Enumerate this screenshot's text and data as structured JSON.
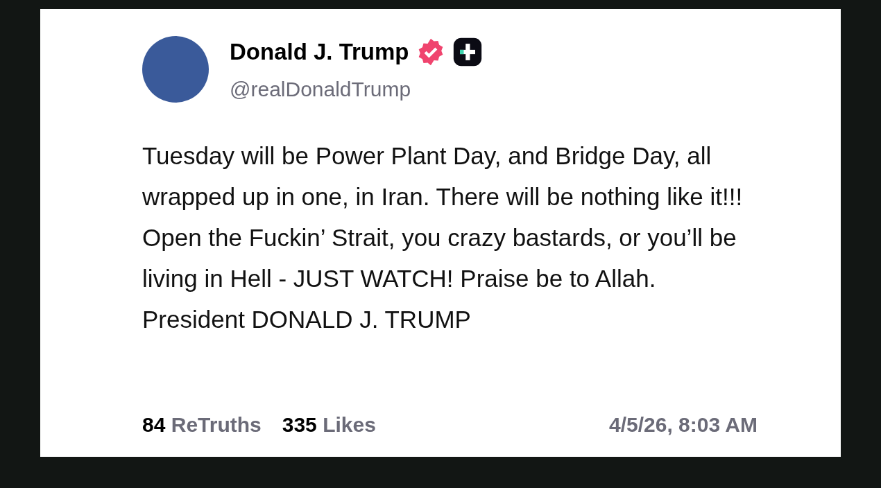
{
  "post": {
    "author": {
      "name": "Donald J. Trump",
      "handle": "@realDonaldTrump",
      "verified": true
    },
    "text": "Tuesday will be Power Plant Day, and Bridge Day, all wrapped up in one, in Iran. There will be nothing like it!!! Open the Fuckin’ Strait, you crazy bastards, or you’ll be living in Hell - JUST WATCH! Praise be to Allah. President DONALD J. TRUMP",
    "stats": [
      {
        "count": "84",
        "label": "ReTruths"
      },
      {
        "count": "335",
        "label": "Likes"
      }
    ],
    "timestamp": "4/5/26, 8:03 AM"
  }
}
